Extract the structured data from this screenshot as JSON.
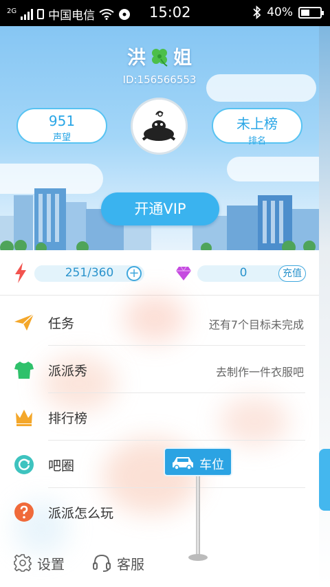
{
  "status_bar": {
    "network_type": "2G",
    "carrier": "中国电信",
    "time": "15:02",
    "battery": "40%",
    "battery_level": 0.4
  },
  "profile": {
    "name_part1": "洪",
    "name_part2": "姐",
    "id": "ID:156566553",
    "reputation_value": "951",
    "reputation_label": "声望",
    "rank_value": "未上榜",
    "rank_label": "排名",
    "vip_button": "开通VIP"
  },
  "energy": {
    "text": "251/360",
    "current": 251,
    "max": 360
  },
  "gems": {
    "value": "0",
    "recharge_label": "充值"
  },
  "menu": [
    {
      "label": "任务",
      "hint": "还有7个目标未完成",
      "icon": "paper-plane-icon"
    },
    {
      "label": "派派秀",
      "hint": "去制作一件衣服吧",
      "icon": "tshirt-icon"
    },
    {
      "label": "排行榜",
      "hint": "",
      "icon": "crown-icon"
    },
    {
      "label": "吧圈",
      "hint": "",
      "icon": "refresh-circle-icon"
    },
    {
      "label": "派派怎么玩",
      "hint": "",
      "icon": "question-icon"
    }
  ],
  "bottom": {
    "settings_label": "设置",
    "service_label": "客服"
  },
  "parking_sign": {
    "label": "车位"
  },
  "colors": {
    "accent": "#3ab3ef",
    "header_sky": "#86c6f3",
    "energy_red": "#f2544f",
    "gem_purple": "#c54be0",
    "tshirt_green": "#2fc16b",
    "crown_orange": "#f4a72a",
    "refresh_teal": "#3ec3bf",
    "question_orange": "#f06a3a"
  }
}
